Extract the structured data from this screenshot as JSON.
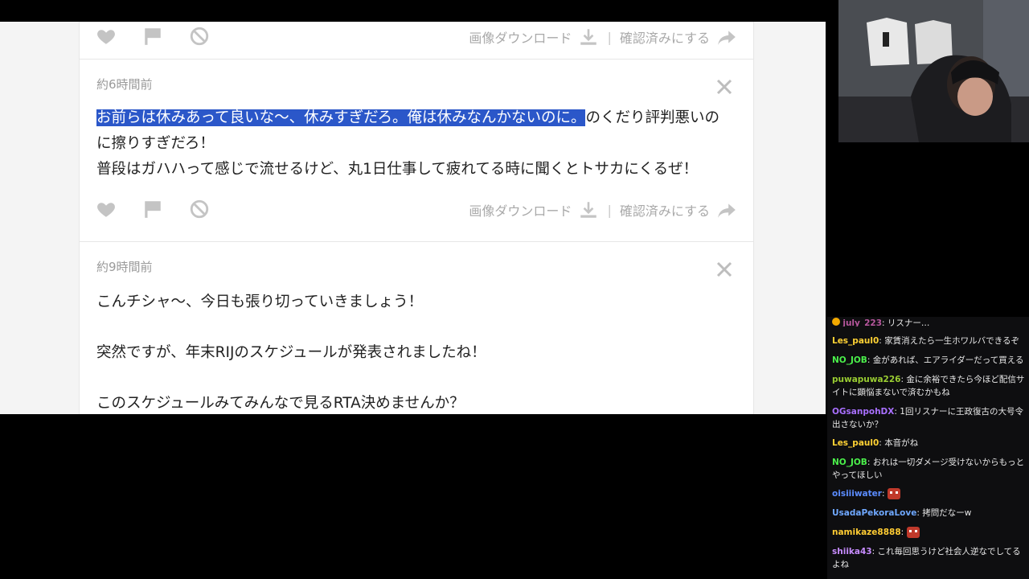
{
  "cards": [
    {
      "actions": {
        "download": "画像ダウンロード",
        "confirm": "確認済みにする"
      }
    },
    {
      "time": "約6時間前",
      "text_highlight": "お前らは休みあって良いな〜、休みすぎだろ。俺は休みなんかないのに。",
      "text_rest": "のくだり評判悪いのに擦りすぎだろ！",
      "text_line2": "普段はガハハって感じで流せるけど、丸1日仕事して疲れてる時に聞くとトサカにくるぜ！",
      "actions": {
        "download": "画像ダウンロード",
        "confirm": "確認済みにする"
      }
    },
    {
      "time": "約9時間前",
      "lines": [
        "こんチシャ〜、今日も張り切っていきましょう！",
        "突然ですが、年末RIJのスケジュールが発表されましたね！",
        "このスケジュールみてみんなで見るRTA決めませんか？"
      ]
    }
  ],
  "chat": [
    {
      "user": "july_223",
      "text": "リスナー…",
      "color": "#b7579d"
    },
    {
      "user": "Les_paul0",
      "text": "家賃消えたら一生ホワルバできるぞ",
      "color": "#ffd234"
    },
    {
      "user": "NO_JOB",
      "text": "金があれば、エアライダーだって買える",
      "color": "#4bf04b"
    },
    {
      "user": "puwapuwa226",
      "text": "金に余裕できたら今ほど配信サイトに顕悩まないで済むかもね",
      "color": "#9acd32"
    },
    {
      "user": "OGsanpohDX",
      "text": "1回リスナーに王政復古の大号令出さないか？",
      "color": "#a970ff"
    },
    {
      "user": "Les_paul0",
      "text": "本音がね",
      "color": "#ffd234"
    },
    {
      "user": "NO_JOB",
      "text": "おれは一切ダメージ受けないからもっとやってほしい",
      "color": "#4bf04b"
    },
    {
      "user": "oisiiiwater",
      "text": "",
      "color": "#5b8cff",
      "emote": true
    },
    {
      "user": "UsadaPekoraLove",
      "text": "拷問だなーw",
      "color": "#6fa8ff"
    },
    {
      "user": "namikaze8888",
      "text": "",
      "color": "#ffcc33",
      "emote": true
    },
    {
      "user": "shiika43",
      "text": "これ毎回思うけど社会人逆なでしてるよね",
      "color": "#c78cff"
    }
  ],
  "colors": {
    "highlight": "#2b57c9",
    "panel_bg": "#f4f4f4",
    "icon": "#c4c4c4"
  },
  "icons": [
    "heart-icon",
    "flag-icon",
    "block-icon",
    "download-icon",
    "share-arrow-icon",
    "close-icon"
  ]
}
